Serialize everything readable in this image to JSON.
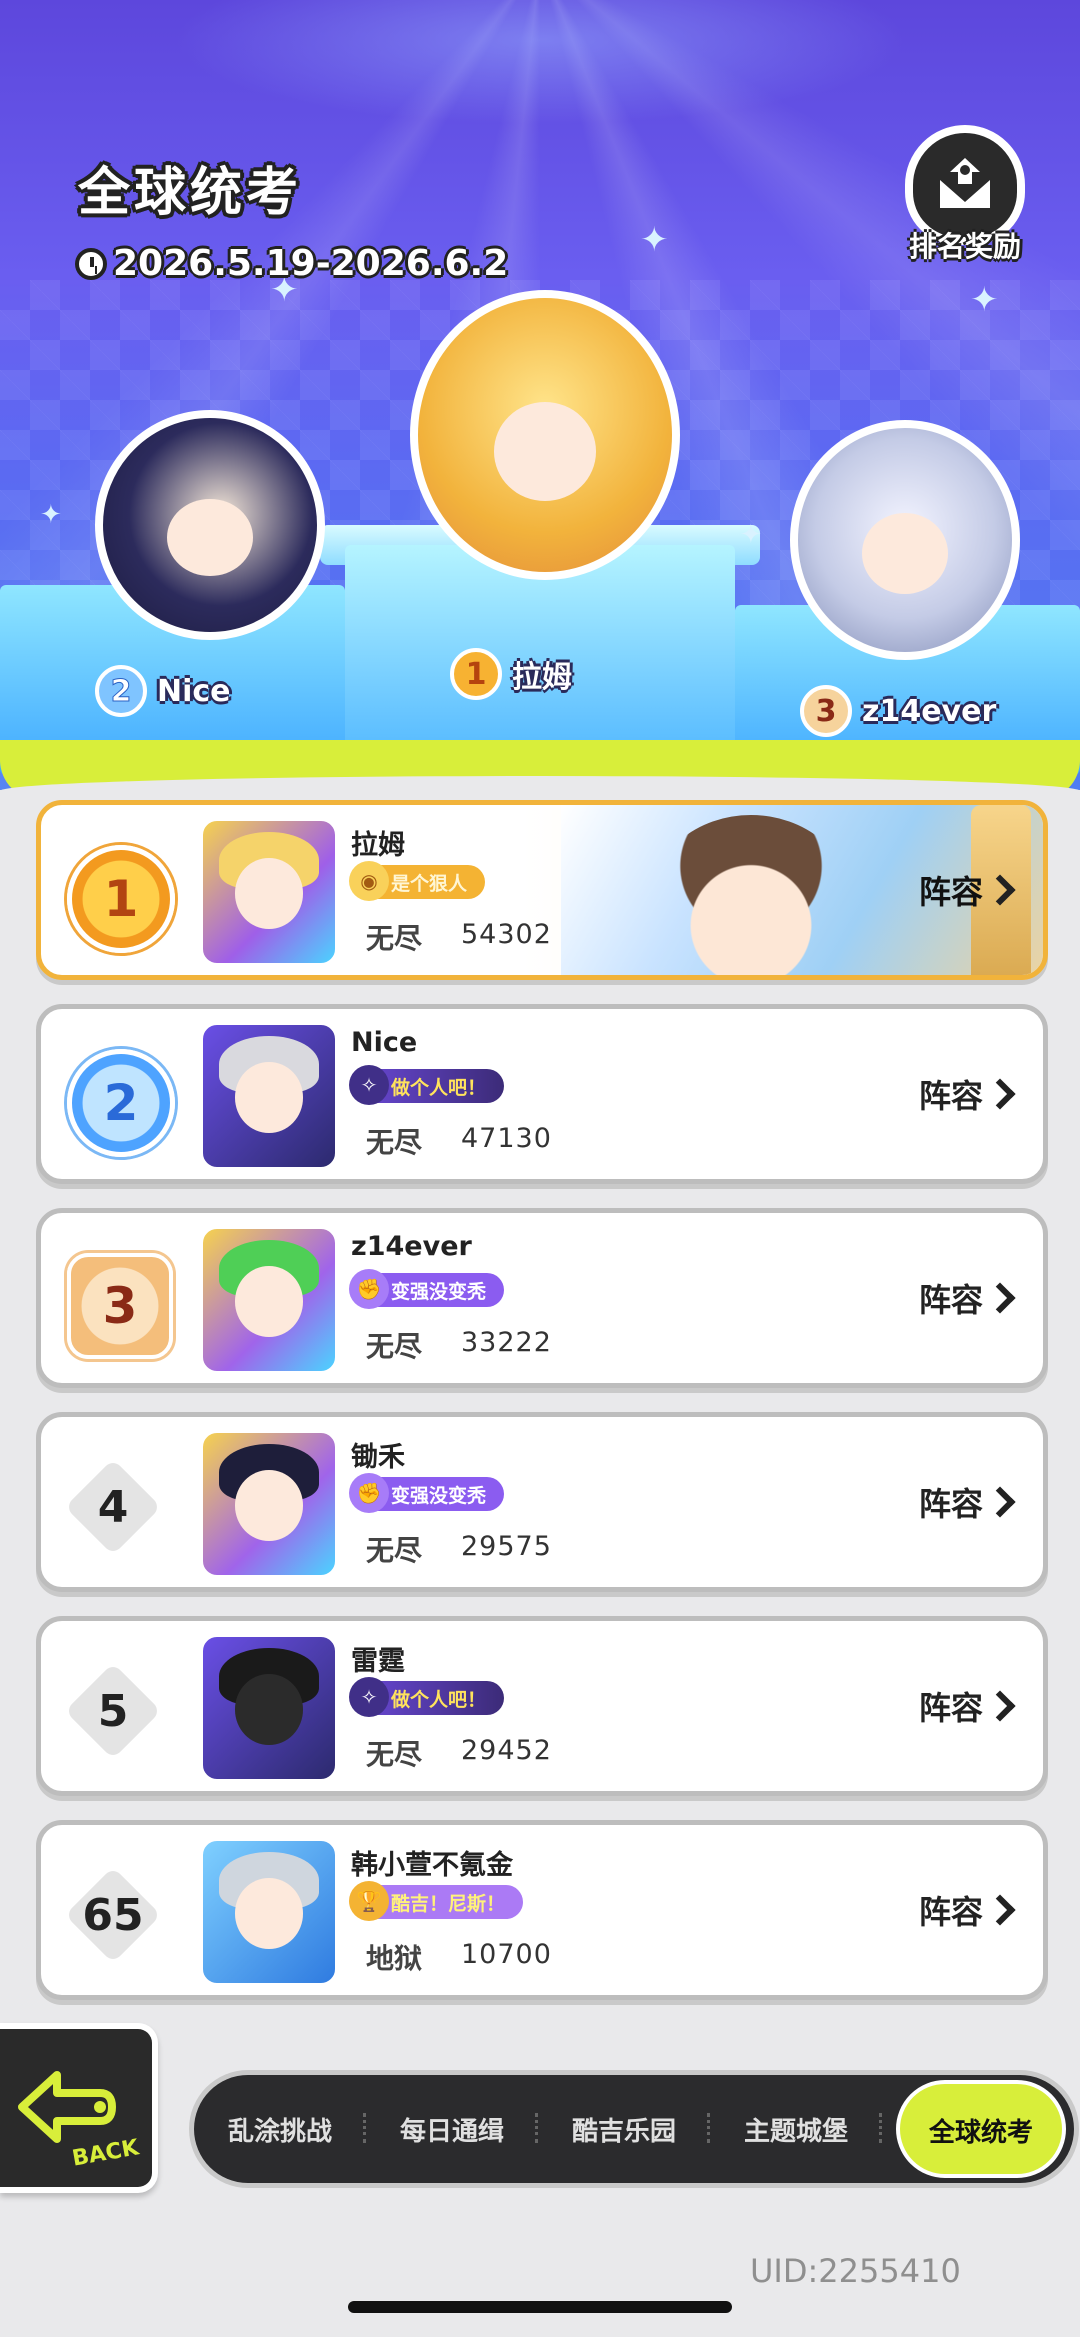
{
  "event": {
    "title": "全球统考",
    "date_range": "2026.5.19-2026.6.2",
    "reward_label": "排名奖励"
  },
  "podium": [
    {
      "rank": "1",
      "name": "拉姆"
    },
    {
      "rank": "2",
      "name": "Nice"
    },
    {
      "rank": "3",
      "name": "z14ever"
    }
  ],
  "leaderboard": [
    {
      "rank": "1",
      "name": "拉姆",
      "title": "是个狠人",
      "mode": "无尽",
      "score": "54302",
      "lineup": "阵容"
    },
    {
      "rank": "2",
      "name": "Nice",
      "title": "做个人吧！",
      "mode": "无尽",
      "score": "47130",
      "lineup": "阵容"
    },
    {
      "rank": "3",
      "name": "z14ever",
      "title": "变强没变秃",
      "mode": "无尽",
      "score": "33222",
      "lineup": "阵容"
    },
    {
      "rank": "4",
      "name": "锄禾",
      "title": "变强没变秃",
      "mode": "无尽",
      "score": "29575",
      "lineup": "阵容"
    },
    {
      "rank": "5",
      "name": "雷霆",
      "title": "做个人吧！",
      "mode": "无尽",
      "score": "29452",
      "lineup": "阵容"
    },
    {
      "rank": "65",
      "name": "韩小萱不氪金",
      "title": "酷吉！尼斯！",
      "mode": "地狱",
      "score": "10700",
      "lineup": "阵容"
    }
  ],
  "back_label": "BACK",
  "tabs": [
    "乱涂挑战",
    "每日通缉",
    "酷吉乐园",
    "主题城堡",
    "全球统考"
  ],
  "active_tab": "全球统考",
  "uid": "UID:2255410",
  "colors": {
    "accent_lime": "#d8ee3a",
    "gold": "#f4b333",
    "hero_purple": "#5d47dc",
    "card_border": "#bdbdbd",
    "first_card_border": "#f1b33b"
  }
}
